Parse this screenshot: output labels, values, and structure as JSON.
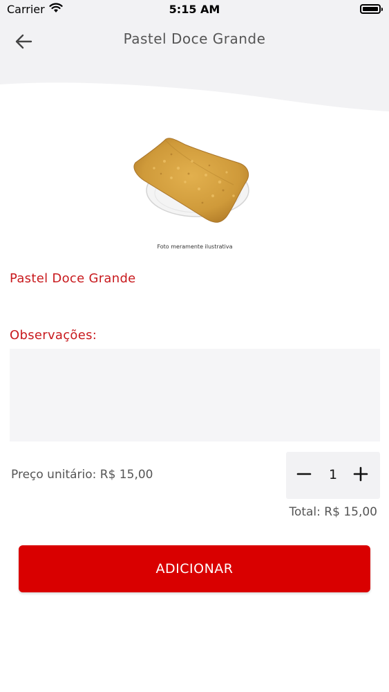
{
  "status_bar": {
    "carrier": "Carrier",
    "time": "5:15 AM",
    "icons": [
      "wifi-icon",
      "battery-icon"
    ]
  },
  "header": {
    "title": "Pastel Doce Grande",
    "back_icon": "arrow-left-icon",
    "background_color": "#f2f2f4"
  },
  "product": {
    "image_caption": "Foto meramente ilustrativa",
    "name": "Pastel Doce Grande"
  },
  "observations": {
    "label": "Observações:",
    "value": ""
  },
  "pricing": {
    "unit_price": "Preço unitário: R$ 15,00",
    "quantity": "1",
    "total": "Total: R$ 15,00"
  },
  "actions": {
    "add_label": "ADICIONAR"
  },
  "colors": {
    "accent": "#c8191d",
    "button": "#d90000"
  }
}
